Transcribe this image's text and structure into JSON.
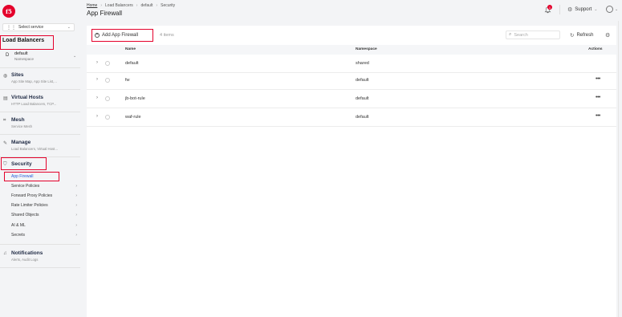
{
  "brand": {
    "logo_text": "f5",
    "accent": "#e4002b",
    "link_color": "#2b5fd9"
  },
  "breadcrumb": [
    "Home",
    "Load Balancers",
    "default",
    "Security"
  ],
  "page_title": "App Firewall",
  "header": {
    "notification_count": "1",
    "support_label": "Support"
  },
  "sidebar": {
    "service_select": "Select service",
    "workspace_title": "Load Balancers",
    "namespace": {
      "initial": "D",
      "name": "default",
      "label": "Namespace"
    },
    "sections": [
      {
        "icon": "sites-icon",
        "title": "Sites",
        "subtitle": "App Site Map, App Site List,..."
      },
      {
        "icon": "virtual-hosts-icon",
        "title": "Virtual Hosts",
        "subtitle": "HTTP Load Balancers, TCP..."
      },
      {
        "icon": "mesh-icon",
        "title": "Mesh",
        "subtitle": "Service Mesh"
      },
      {
        "icon": "manage-icon",
        "title": "Manage",
        "subtitle": "Load Balancers, Virtual Host..."
      },
      {
        "icon": "shield-icon",
        "title": "Security",
        "subtitle": ""
      },
      {
        "icon": "bell-icon",
        "title": "Notifications",
        "subtitle": "Alerts, Audit Logs"
      }
    ],
    "security_items": [
      {
        "label": "App Firewall",
        "active": true,
        "has_children": false
      },
      {
        "label": "Service Policies",
        "active": false,
        "has_children": true
      },
      {
        "label": "Forward Proxy Policies",
        "active": false,
        "has_children": true
      },
      {
        "label": "Rate Limiter Policies",
        "active": false,
        "has_children": true
      },
      {
        "label": "Shared Objects",
        "active": false,
        "has_children": true
      },
      {
        "label": "AI & ML",
        "active": false,
        "has_children": true
      },
      {
        "label": "Secrets",
        "active": false,
        "has_children": true
      }
    ]
  },
  "toolbar": {
    "add_label": "Add App Firewall",
    "count": "4 items",
    "search_placeholder": "Search",
    "refresh_label": "Refresh"
  },
  "table": {
    "columns": [
      "Name",
      "Namespace",
      "Actions"
    ],
    "rows": [
      {
        "name": "default",
        "namespace": "shared",
        "has_actions": false
      },
      {
        "name": "fw",
        "namespace": "default",
        "has_actions": true
      },
      {
        "name": "jb-bot-rule",
        "namespace": "default",
        "has_actions": true
      },
      {
        "name": "waf-rule",
        "namespace": "default",
        "has_actions": true
      }
    ]
  }
}
